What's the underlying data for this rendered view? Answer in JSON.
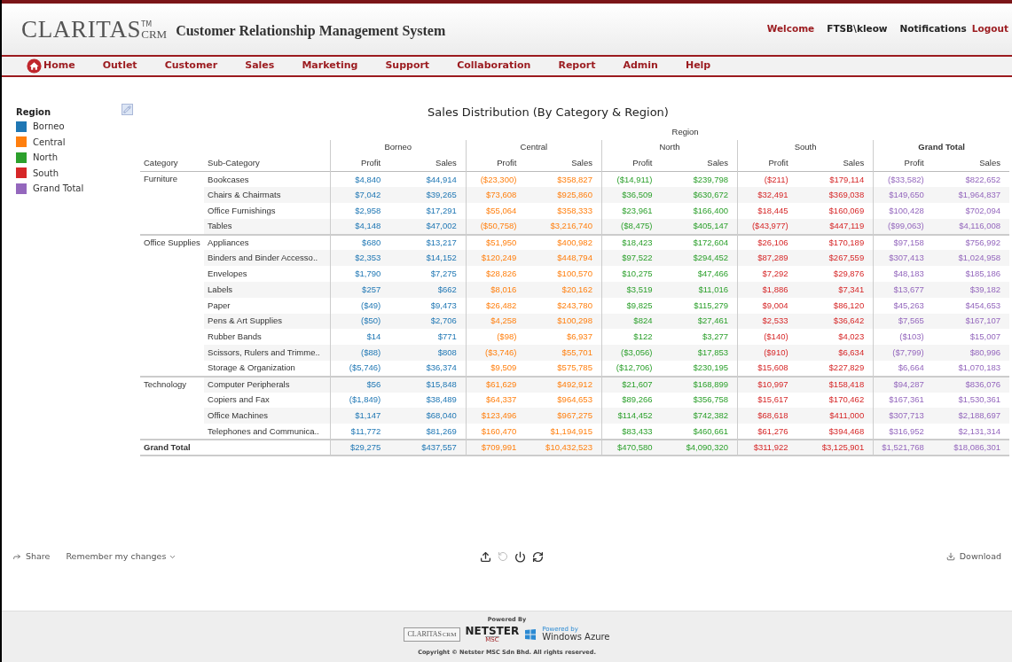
{
  "header": {
    "logo": {
      "name": "CLARITAS",
      "suffix": "CRM",
      "tm": "TM"
    },
    "title": "Customer Relationship Management System",
    "welcome": "Welcome",
    "user": "FTSB\\kleow",
    "links": [
      "Notifications",
      "Logout"
    ]
  },
  "nav": [
    {
      "label": "Home",
      "kind": "home"
    },
    {
      "label": "Outlet",
      "kind": "plain"
    },
    {
      "label": "Customer",
      "kind": "plain"
    },
    {
      "label": "Sales",
      "kind": "plain"
    },
    {
      "label": "Marketing",
      "kind": "plain"
    },
    {
      "label": "Support",
      "kind": "plain"
    },
    {
      "label": "Collaboration",
      "kind": "plain"
    },
    {
      "label": "Report",
      "kind": "plain"
    },
    {
      "label": "Admin",
      "kind": "plain"
    },
    {
      "label": "Help",
      "kind": "plain"
    }
  ],
  "legend": {
    "title": "Region",
    "items": [
      {
        "label": "Borneo",
        "color": "#1f77b4"
      },
      {
        "label": "Central",
        "color": "#ff7f0e"
      },
      {
        "label": "North",
        "color": "#2ca02c"
      },
      {
        "label": "South",
        "color": "#d62728"
      },
      {
        "label": "Grand Total",
        "color": "#9467bd"
      }
    ]
  },
  "report": {
    "title": "Sales Distribution (By Category & Region)",
    "region_label": "Region",
    "row_headers": [
      "Category",
      "Sub-Category"
    ],
    "regions": [
      {
        "name": "Borneo",
        "measures": [
          "Profit",
          "Sales"
        ]
      },
      {
        "name": "Central",
        "measures": [
          "Profit",
          "Sales"
        ]
      },
      {
        "name": "North",
        "measures": [
          "Profit",
          "Sales"
        ]
      },
      {
        "name": "South",
        "measures": [
          "Profit",
          "Sales"
        ]
      },
      {
        "name": "Grand Total",
        "measures": [
          "Profit",
          "Sales"
        ]
      }
    ],
    "groups": [
      {
        "category": "Furniture",
        "rows": [
          {
            "sub": "Bookcases",
            "values": [
              "$4,840",
              "$44,914",
              "($23,300)",
              "$358,827",
              "($14,911)",
              "$239,798",
              "($211)",
              "$179,114",
              "($33,582)",
              "$822,652"
            ]
          },
          {
            "sub": "Chairs & Chairmats",
            "values": [
              "$7,042",
              "$39,265",
              "$73,608",
              "$925,860",
              "$36,509",
              "$630,672",
              "$32,491",
              "$369,038",
              "$149,650",
              "$1,964,837"
            ]
          },
          {
            "sub": "Office Furnishings",
            "values": [
              "$2,958",
              "$17,291",
              "$55,064",
              "$358,333",
              "$23,961",
              "$166,400",
              "$18,445",
              "$160,069",
              "$100,428",
              "$702,094"
            ]
          },
          {
            "sub": "Tables",
            "values": [
              "$4,148",
              "$47,002",
              "($50,758)",
              "$3,216,740",
              "($8,475)",
              "$405,147",
              "($43,977)",
              "$447,119",
              "($99,063)",
              "$4,116,008"
            ]
          }
        ]
      },
      {
        "category": "Office Supplies",
        "rows": [
          {
            "sub": "Appliances",
            "values": [
              "$680",
              "$13,217",
              "$51,950",
              "$400,982",
              "$18,423",
              "$172,604",
              "$26,106",
              "$170,189",
              "$97,158",
              "$756,992"
            ]
          },
          {
            "sub": "Binders and Binder Accesso..",
            "values": [
              "$2,353",
              "$14,152",
              "$120,249",
              "$448,794",
              "$97,522",
              "$294,452",
              "$87,289",
              "$267,559",
              "$307,413",
              "$1,024,958"
            ]
          },
          {
            "sub": "Envelopes",
            "values": [
              "$1,790",
              "$7,275",
              "$28,826",
              "$100,570",
              "$10,275",
              "$47,466",
              "$7,292",
              "$29,876",
              "$48,183",
              "$185,186"
            ]
          },
          {
            "sub": "Labels",
            "values": [
              "$257",
              "$662",
              "$8,016",
              "$20,162",
              "$3,519",
              "$11,016",
              "$1,886",
              "$7,341",
              "$13,677",
              "$39,182"
            ]
          },
          {
            "sub": "Paper",
            "values": [
              "($49)",
              "$9,473",
              "$26,482",
              "$243,780",
              "$9,825",
              "$115,279",
              "$9,004",
              "$86,120",
              "$45,263",
              "$454,653"
            ]
          },
          {
            "sub": "Pens & Art Supplies",
            "values": [
              "($50)",
              "$2,706",
              "$4,258",
              "$100,298",
              "$824",
              "$27,461",
              "$2,533",
              "$36,642",
              "$7,565",
              "$167,107"
            ]
          },
          {
            "sub": "Rubber Bands",
            "values": [
              "$14",
              "$771",
              "($98)",
              "$6,937",
              "$122",
              "$3,277",
              "($140)",
              "$4,023",
              "($103)",
              "$15,007"
            ]
          },
          {
            "sub": "Scissors, Rulers and Trimme..",
            "values": [
              "($88)",
              "$808",
              "($3,746)",
              "$55,701",
              "($3,056)",
              "$17,853",
              "($910)",
              "$6,634",
              "($7,799)",
              "$80,996"
            ]
          },
          {
            "sub": "Storage & Organization",
            "values": [
              "($5,746)",
              "$36,374",
              "$9,509",
              "$575,785",
              "($12,706)",
              "$230,195",
              "$15,608",
              "$227,829",
              "$6,664",
              "$1,070,183"
            ]
          }
        ]
      },
      {
        "category": "Technology",
        "rows": [
          {
            "sub": "Computer Peripherals",
            "values": [
              "$56",
              "$15,848",
              "$61,629",
              "$492,912",
              "$21,607",
              "$168,899",
              "$10,997",
              "$158,418",
              "$94,287",
              "$836,076"
            ]
          },
          {
            "sub": "Copiers and Fax",
            "values": [
              "($1,849)",
              "$38,489",
              "$64,337",
              "$964,653",
              "$89,266",
              "$356,758",
              "$15,617",
              "$170,462",
              "$167,361",
              "$1,530,361"
            ]
          },
          {
            "sub": "Office Machines",
            "values": [
              "$1,147",
              "$68,040",
              "$123,496",
              "$967,275",
              "$114,452",
              "$742,382",
              "$68,618",
              "$411,000",
              "$307,713",
              "$2,188,697"
            ]
          },
          {
            "sub": "Telephones and Communica..",
            "values": [
              "$11,772",
              "$81,269",
              "$160,470",
              "$1,194,915",
              "$83,433",
              "$460,661",
              "$61,276",
              "$394,468",
              "$316,952",
              "$2,131,314"
            ]
          }
        ]
      }
    ],
    "total": {
      "label": "Grand Total",
      "values": [
        "$29,275",
        "$437,557",
        "$709,991",
        "$10,432,523",
        "$470,580",
        "$4,090,320",
        "$311,922",
        "$3,125,901",
        "$1,521,768",
        "$18,086,301"
      ]
    }
  },
  "toolbar": {
    "share": "Share",
    "remember": "Remember my changes",
    "download": "Download"
  },
  "footer": {
    "powered_by": "Powered By",
    "claritas": "CLARITAS",
    "claritas_suffix": "CRM",
    "netster": "NETSTER",
    "msc": "MSC",
    "azure_small": "Powered by",
    "azure": "Windows Azure",
    "copyright": "Copyright © Netster MSC Sdn Bhd. All rights reserved."
  }
}
